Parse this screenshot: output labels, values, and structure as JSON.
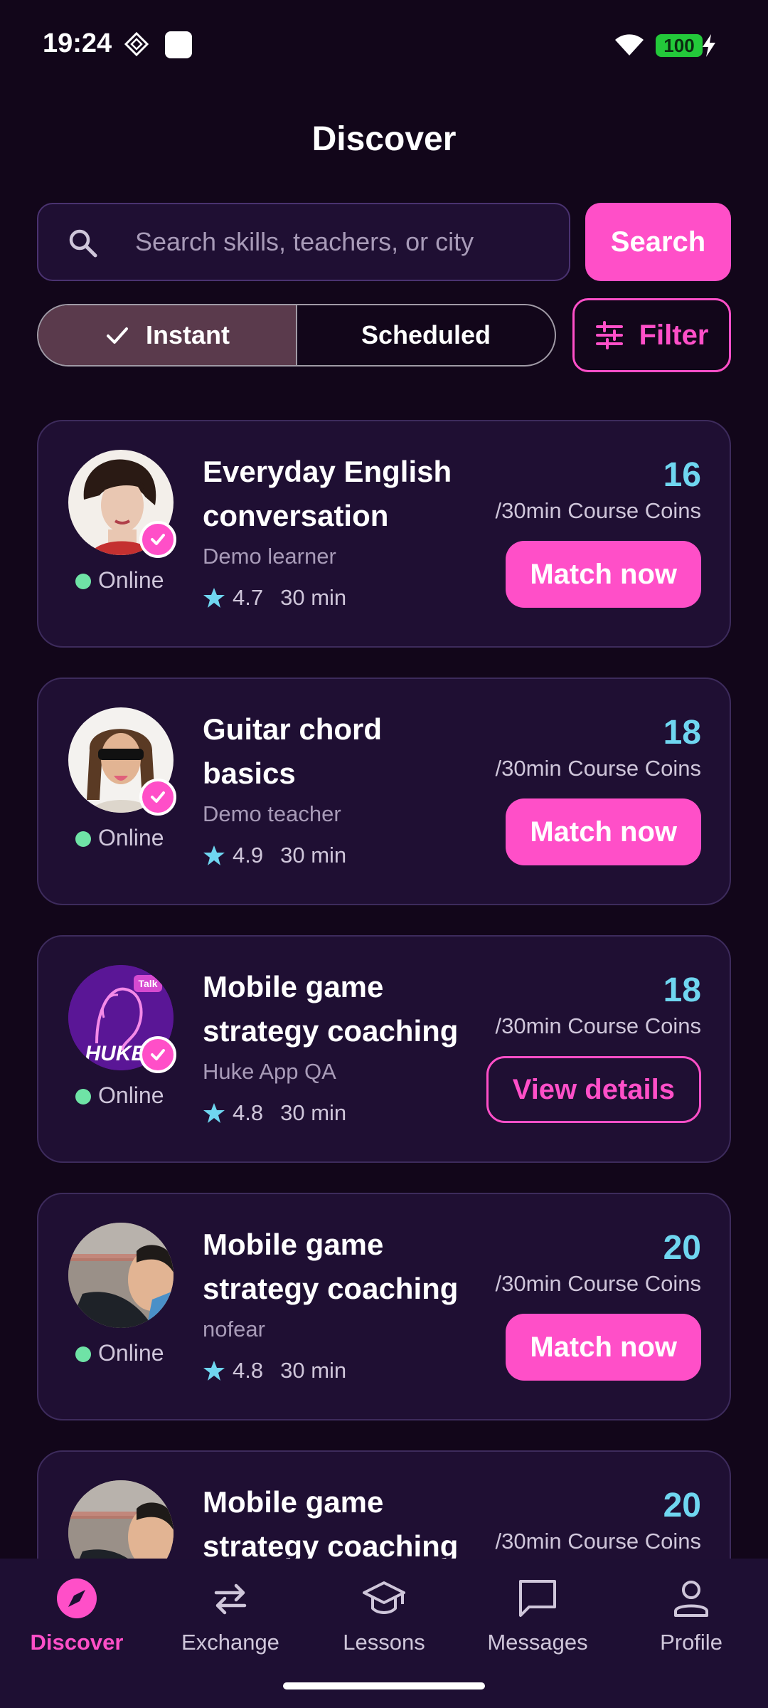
{
  "status_bar": {
    "time": "19:24",
    "battery": "100"
  },
  "header": {
    "title": "Discover"
  },
  "search": {
    "placeholder": "Search skills, teachers, or city",
    "button_label": "Search"
  },
  "mode_toggle": {
    "options": [
      "Instant",
      "Scheduled"
    ],
    "selected": "Instant"
  },
  "filter": {
    "label": "Filter"
  },
  "cards": [
    {
      "title": "Everyday English conversation",
      "teacher": "Demo learner",
      "rating": "4.7",
      "duration": "30 min",
      "price": "16",
      "unit": "/30min Course Coins",
      "status": "Online",
      "action": "Match now",
      "action_style": "primary"
    },
    {
      "title": "Guitar chord basics",
      "teacher": "Demo teacher",
      "rating": "4.9",
      "duration": "30 min",
      "price": "18",
      "unit": "/30min Course Coins",
      "status": "Online",
      "action": "Match now",
      "action_style": "primary"
    },
    {
      "title": "Mobile game strategy coaching",
      "teacher": "Huke App QA",
      "rating": "4.8",
      "duration": "30 min",
      "price": "18",
      "unit": "/30min Course Coins",
      "status": "Online",
      "action": "View details",
      "action_style": "outline"
    },
    {
      "title": "Mobile game strategy coaching",
      "teacher": "nofear",
      "rating": "4.8",
      "duration": "30 min",
      "price": "20",
      "unit": "/30min Course Coins",
      "status": "Online",
      "action": "Match now",
      "action_style": "primary"
    },
    {
      "title": "Mobile game strategy coaching",
      "price": "20",
      "unit": "/30min Course Coins"
    }
  ],
  "avatar_texts": {
    "talk_badge": "Talk",
    "brand": "HUKE"
  },
  "bottom_nav": [
    {
      "label": "Discover",
      "icon": "compass-icon",
      "active": true
    },
    {
      "label": "Exchange",
      "icon": "swap-arrows-icon",
      "active": false
    },
    {
      "label": "Lessons",
      "icon": "graduation-cap-icon",
      "active": false
    },
    {
      "label": "Messages",
      "icon": "chat-bubble-icon",
      "active": false
    },
    {
      "label": "Profile",
      "icon": "person-icon",
      "active": false
    }
  ],
  "colors": {
    "background": "#12061a",
    "card": "#1f0f33",
    "accent": "#ff4fc8",
    "price": "#6fd6f0",
    "online": "#6fe3a6",
    "star": "#6fd6f0"
  }
}
